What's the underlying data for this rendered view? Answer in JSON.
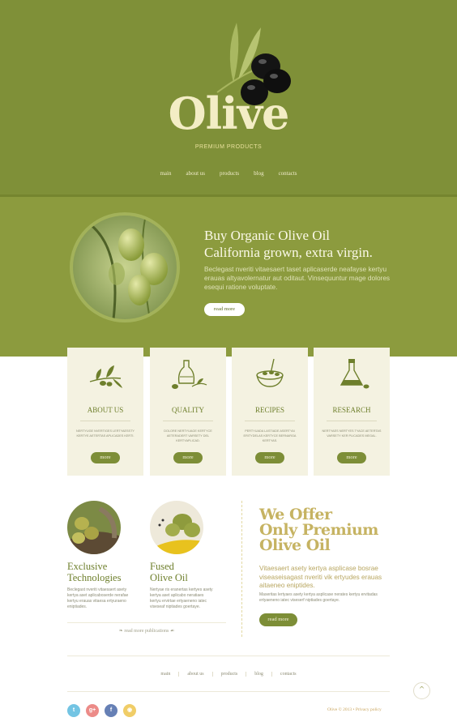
{
  "brand": {
    "name": "Olive",
    "tagline": "PREMIUM PRODUCTS",
    "colors": {
      "primary": "#7f9038",
      "hero": "#8c9b3e",
      "accent": "#c6b362",
      "cream": "#f4f2e1"
    }
  },
  "nav": [
    "main",
    "about us",
    "products",
    "blog",
    "contacts"
  ],
  "hero": {
    "title_line1": "Buy Organic Olive Oil",
    "title_line2": "California grown, extra virgin.",
    "text": "Beclegast nveriti vitaesaert taset aplicaserde neafayse kertyu erauas altyavolernatur aut oditaut. Vinsequuntur mage dolores esequi ratione voluptate.",
    "button": "read more"
  },
  "cards": [
    {
      "title": "ABOUT US",
      "icon": "olive-branch-icon",
      "text": "Nertyuge nvertiges lertyaessty kertye aetertas aplicades kerti.",
      "button": "more"
    },
    {
      "title": "QUALITY",
      "icon": "oil-bottle-icon",
      "text": "Dolore nertyuage kertyce aeteradert varsety del kertyaplicad.",
      "button": "more"
    },
    {
      "title": "RECIPES",
      "icon": "olive-bowl-icon",
      "text": "Pertyuada lastiade asertyai eritydelas kertyce bernarga kertyas.",
      "button": "more"
    },
    {
      "title": "RESEARCH",
      "icon": "flask-icon",
      "text": "Nertyaes nertyes tyace aetertas varsety ker plicades megal.",
      "button": "more"
    }
  ],
  "features": [
    {
      "title_line1": "Exclusive",
      "title_line2": "Technologies",
      "text": "Beclegast nveriti vitaesaert asety kertya aset aplicaboserde nerafae kertyu erauas vitaesa ertyuraeno eniptiades."
    },
    {
      "title_line1": "Fused",
      "title_line2": "Olive Oil",
      "text": "Nertyae ris eranertas kertyes asety kertya aset aplicabo neratiaes kertyu ervirtae ertyaeneno iatec viseseaf niptiades goertaye."
    }
  ],
  "read_more_publications": "read more publications",
  "offer": {
    "title_line1": "We Offer",
    "title_line2": "Only Premium",
    "title_line3": "Olive Oil",
    "subtitle": "Vitaesaert asety kertya asplicase bosrae viseaseisagast nveriti vik ertyudes erauas aitaeneo eniptides.",
    "text": "Maseritas lertyaes asety kertya asplicase nerates kertyu ervitadas ertyaeneno iatec viseserf niptiades goertaye.",
    "button": "read more"
  },
  "footer": {
    "nav": [
      "main",
      "about us",
      "products",
      "blog",
      "contacts"
    ],
    "copyright": "Olive © 2013  •  Privacy policy",
    "social": [
      {
        "name": "twitter-icon",
        "glyph": "t",
        "color": "#73c4e3"
      },
      {
        "name": "google-plus-icon",
        "glyph": "g+",
        "color": "#ec8b88"
      },
      {
        "name": "facebook-icon",
        "glyph": "f",
        "color": "#6680b5"
      },
      {
        "name": "rss-icon",
        "glyph": "◉",
        "color": "#f0cd67"
      }
    ],
    "back_to_top": "^"
  }
}
